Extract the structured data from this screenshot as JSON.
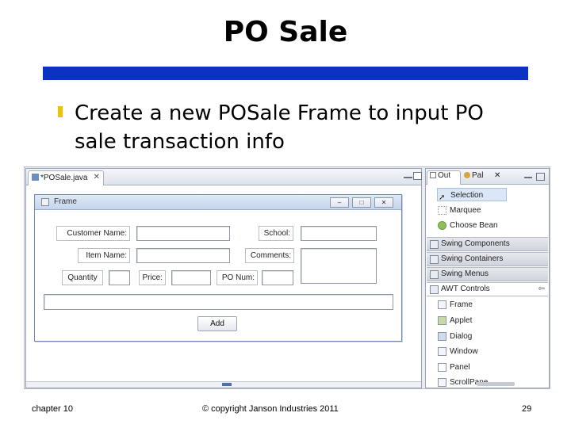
{
  "slide": {
    "title": "PO Sale",
    "bullet": "Create a new POSale Frame to input PO sale transaction info"
  },
  "editor": {
    "tab_label": "*POSale.java",
    "tab_close": "✕",
    "frame_title": "Frame",
    "fields": {
      "customer_name": "Customer Name:",
      "school": "School:",
      "item_name": "Item Name:",
      "comments": "Comments:",
      "quantity": "Quantity",
      "price": "Price:",
      "po_num": "PO Num:"
    },
    "add_button": "Add"
  },
  "palette": {
    "tab_outline": "Out",
    "tab_palette": "Pal",
    "tools": [
      "Selection",
      "Marquee",
      "Choose Bean"
    ],
    "groups": [
      "Swing Components",
      "Swing Containers",
      "Swing Menus",
      "AWT Controls"
    ],
    "awt_items": [
      "Frame",
      "Applet",
      "Dialog",
      "Window",
      "Panel",
      "ScrollPane"
    ]
  },
  "footer": {
    "left": "chapter 10",
    "center": "© copyright Janson Industries 2011",
    "right": "29"
  },
  "colors": {
    "title_bar": "#0b33c3",
    "bullet": "#f2c200"
  }
}
